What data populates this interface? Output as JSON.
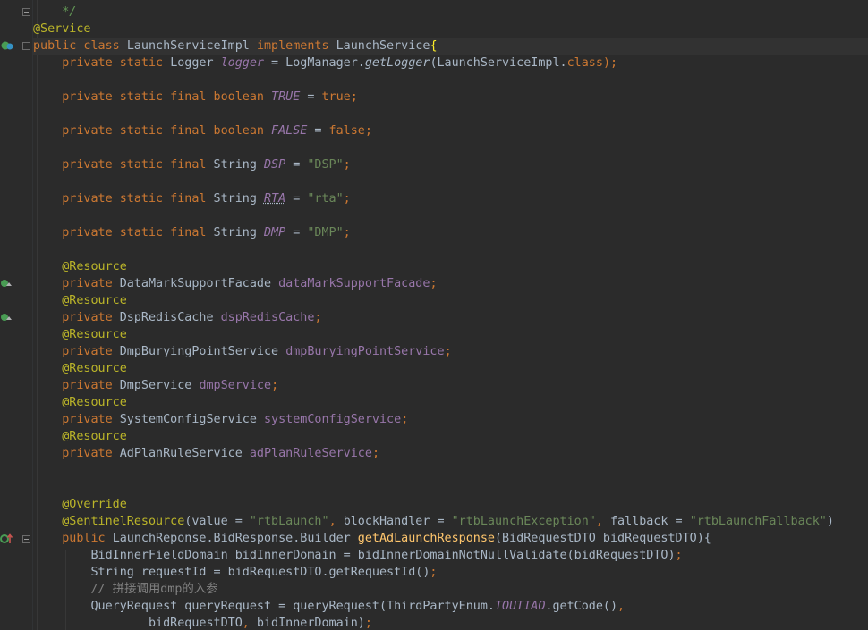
{
  "editor": {
    "lines": [
      {
        "tokens": [
          {
            "t": "    ",
            "c": "plain"
          },
          {
            "t": "*/",
            "c": "cmt"
          }
        ]
      },
      {
        "tokens": [
          {
            "t": "@Service",
            "c": "ann"
          }
        ]
      },
      {
        "current": true,
        "tokens": [
          {
            "t": "public class ",
            "c": "kw"
          },
          {
            "t": "LaunchServiceImpl ",
            "c": "plain"
          },
          {
            "t": "implements ",
            "c": "kw"
          },
          {
            "t": "LaunchService",
            "c": "plain"
          },
          {
            "t": "{",
            "c": "brace"
          }
        ]
      },
      {
        "tokens": [
          {
            "t": "    private static ",
            "c": "kw"
          },
          {
            "t": "Logger ",
            "c": "plain"
          },
          {
            "t": "logger",
            "c": "ifield"
          },
          {
            "t": " = LogManager.",
            "c": "plain"
          },
          {
            "t": "getLogger",
            "c": "smethod"
          },
          {
            "t": "(LaunchServiceImpl.",
            "c": "plain"
          },
          {
            "t": "class",
            "c": "kw"
          },
          {
            "t": ");",
            "c": "kw"
          }
        ]
      },
      {
        "tokens": []
      },
      {
        "tokens": [
          {
            "t": "    private static final boolean ",
            "c": "kw"
          },
          {
            "t": "TRUE",
            "c": "ifield"
          },
          {
            "t": " = ",
            "c": "plain"
          },
          {
            "t": "true;",
            "c": "kw"
          }
        ]
      },
      {
        "tokens": []
      },
      {
        "tokens": [
          {
            "t": "    private static final boolean ",
            "c": "kw"
          },
          {
            "t": "FALSE",
            "c": "ifield"
          },
          {
            "t": " = ",
            "c": "plain"
          },
          {
            "t": "false;",
            "c": "kw"
          }
        ]
      },
      {
        "tokens": []
      },
      {
        "tokens": [
          {
            "t": "    private static final ",
            "c": "kw"
          },
          {
            "t": "String ",
            "c": "plain"
          },
          {
            "t": "DSP",
            "c": "ifield"
          },
          {
            "t": " = ",
            "c": "plain"
          },
          {
            "t": "\"DSP\"",
            "c": "str"
          },
          {
            "t": ";",
            "c": "kw"
          }
        ]
      },
      {
        "tokens": []
      },
      {
        "tokens": [
          {
            "t": "    private static final ",
            "c": "kw"
          },
          {
            "t": "String ",
            "c": "plain"
          },
          {
            "t": "RTA",
            "c": "ifield uline"
          },
          {
            "t": " = ",
            "c": "plain"
          },
          {
            "t": "\"rta\"",
            "c": "str"
          },
          {
            "t": ";",
            "c": "kw"
          }
        ]
      },
      {
        "tokens": []
      },
      {
        "tokens": [
          {
            "t": "    private static final ",
            "c": "kw"
          },
          {
            "t": "String ",
            "c": "plain"
          },
          {
            "t": "DMP",
            "c": "ifield"
          },
          {
            "t": " = ",
            "c": "plain"
          },
          {
            "t": "\"DMP\"",
            "c": "str"
          },
          {
            "t": ";",
            "c": "kw"
          }
        ]
      },
      {
        "tokens": []
      },
      {
        "tokens": [
          {
            "t": "    @Resource",
            "c": "ann"
          }
        ]
      },
      {
        "tokens": [
          {
            "t": "    private ",
            "c": "kw"
          },
          {
            "t": "DataMarkSupportFacade ",
            "c": "plain"
          },
          {
            "t": "dataMarkSupportFacade",
            "c": "field"
          },
          {
            "t": ";",
            "c": "kw"
          }
        ]
      },
      {
        "tokens": [
          {
            "t": "    @Resource",
            "c": "ann"
          }
        ]
      },
      {
        "tokens": [
          {
            "t": "    private ",
            "c": "kw"
          },
          {
            "t": "DspRedisCache ",
            "c": "plain"
          },
          {
            "t": "dspRedisCache",
            "c": "field"
          },
          {
            "t": ";",
            "c": "kw"
          }
        ]
      },
      {
        "tokens": [
          {
            "t": "    @Resource",
            "c": "ann"
          }
        ]
      },
      {
        "tokens": [
          {
            "t": "    private ",
            "c": "kw"
          },
          {
            "t": "DmpBuryingPointService ",
            "c": "plain"
          },
          {
            "t": "dmpBuryingPointService",
            "c": "field"
          },
          {
            "t": ";",
            "c": "kw"
          }
        ]
      },
      {
        "tokens": [
          {
            "t": "    @Resource",
            "c": "ann"
          }
        ]
      },
      {
        "tokens": [
          {
            "t": "    private ",
            "c": "kw"
          },
          {
            "t": "DmpService ",
            "c": "plain"
          },
          {
            "t": "dmpService",
            "c": "field"
          },
          {
            "t": ";",
            "c": "kw"
          }
        ]
      },
      {
        "tokens": [
          {
            "t": "    @Resource",
            "c": "ann"
          }
        ]
      },
      {
        "tokens": [
          {
            "t": "    private ",
            "c": "kw"
          },
          {
            "t": "SystemConfigService ",
            "c": "plain"
          },
          {
            "t": "systemConfigService",
            "c": "field"
          },
          {
            "t": ";",
            "c": "kw"
          }
        ]
      },
      {
        "tokens": [
          {
            "t": "    @Resource",
            "c": "ann"
          }
        ]
      },
      {
        "tokens": [
          {
            "t": "    private ",
            "c": "kw"
          },
          {
            "t": "AdPlanRuleService ",
            "c": "plain"
          },
          {
            "t": "adPlanRuleService",
            "c": "field"
          },
          {
            "t": ";",
            "c": "kw"
          }
        ]
      },
      {
        "tokens": []
      },
      {
        "tokens": []
      },
      {
        "tokens": [
          {
            "t": "    @Override",
            "c": "ann"
          }
        ]
      },
      {
        "tokens": [
          {
            "t": "    @SentinelResource",
            "c": "ann"
          },
          {
            "t": "(value = ",
            "c": "plain"
          },
          {
            "t": "\"rtbLaunch\"",
            "c": "str"
          },
          {
            "t": ", ",
            "c": "kw"
          },
          {
            "t": "blockHandler = ",
            "c": "plain"
          },
          {
            "t": "\"rtbLaunchException\"",
            "c": "str"
          },
          {
            "t": ", ",
            "c": "kw"
          },
          {
            "t": "fallback = ",
            "c": "plain"
          },
          {
            "t": "\"rtbLaunchFallback\"",
            "c": "str"
          },
          {
            "t": ")",
            "c": "plain"
          }
        ]
      },
      {
        "tokens": [
          {
            "t": "    public ",
            "c": "kw"
          },
          {
            "t": "LaunchReponse.BidResponse.Builder ",
            "c": "plain"
          },
          {
            "t": "getAdLaunchResponse",
            "c": "fn"
          },
          {
            "t": "(BidRequestDTO bidRequestDTO){",
            "c": "plain"
          }
        ]
      },
      {
        "tokens": [
          {
            "t": "        BidInnerFieldDomain bidInnerDomain = bidInnerDomainNotNullValidate(bidRequestDTO)",
            "c": "plain"
          },
          {
            "t": ";",
            "c": "kw"
          }
        ]
      },
      {
        "tokens": [
          {
            "t": "        String requestId = bidRequestDTO.getRequestId()",
            "c": "plain"
          },
          {
            "t": ";",
            "c": "kw"
          }
        ]
      },
      {
        "tokens": [
          {
            "t": "        // 拼接调用dmp的入参",
            "c": "lcmt"
          }
        ]
      },
      {
        "tokens": [
          {
            "t": "        QueryRequest queryRequest = queryRequest(ThirdPartyEnum.",
            "c": "plain"
          },
          {
            "t": "TOUTIAO",
            "c": "ifield"
          },
          {
            "t": ".getCode()",
            "c": "plain"
          },
          {
            "t": ",",
            "c": "kw"
          }
        ]
      },
      {
        "tokens": [
          {
            "t": "                bidRequestDTO",
            "c": "plain"
          },
          {
            "t": ", ",
            "c": "kw"
          },
          {
            "t": "bidInnerDomain)",
            "c": "plain"
          },
          {
            "t": ";",
            "c": "kw"
          }
        ]
      }
    ]
  }
}
